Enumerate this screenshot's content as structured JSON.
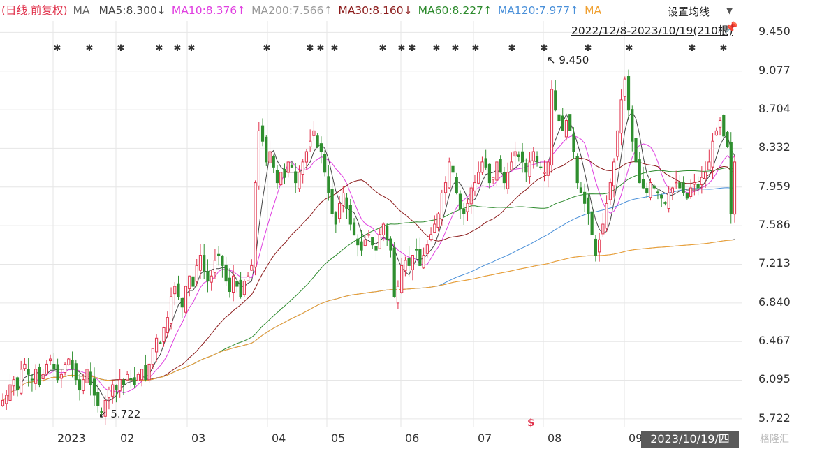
{
  "legend": {
    "prefix": "(日线,前复权)",
    "ma_label": "MA",
    "items": [
      {
        "text": "MA5:8.300↓",
        "color": "#444444"
      },
      {
        "text": "MA10:8.376↑",
        "color": "#e040e0"
      },
      {
        "text": "MA200:7.566↑",
        "color": "#999999"
      },
      {
        "text": "MA30:8.160↓",
        "color": "#8b1a1a"
      },
      {
        "text": "MA60:8.227↑",
        "color": "#2e8b2e"
      },
      {
        "text": "MA120:7.977↑",
        "color": "#4a90d9"
      },
      {
        "text": "MA",
        "color": "#f0a030"
      }
    ]
  },
  "controls": {
    "settings_label": "设置均线",
    "range_text": "2022/12/8-2023/10/19(210根)",
    "pin_icon": "pin-icon",
    "caret_icon": "chevron-down-icon"
  },
  "crosshair_date": "2023/10/19/四",
  "watermark": "格隆汇",
  "annotations": {
    "high": "↖ 9.450",
    "low": "↙ 5.722",
    "marker": "$"
  },
  "colors": {
    "up": "#e0314b",
    "down": "#2f8f2f",
    "grid": "#e6e6e6"
  },
  "chart_data": {
    "type": "candlestick",
    "ylim": [
      5.64,
      9.56
    ],
    "yticks": [
      "9.450",
      "9.077",
      "8.704",
      "8.332",
      "7.959",
      "7.586",
      "7.213",
      "6.840",
      "6.467",
      "6.095",
      "5.722"
    ],
    "xlabels": [
      "2023",
      "02",
      "03",
      "04",
      "05",
      "06",
      "07",
      "08",
      "09"
    ],
    "high_value": 9.45,
    "low_value": 5.722,
    "bar_count": 210,
    "closes": [
      5.9,
      5.95,
      6.05,
      6.1,
      6.0,
      6.2,
      6.25,
      6.15,
      6.1,
      6.2,
      6.05,
      6.15,
      6.25,
      6.3,
      6.2,
      6.1,
      6.15,
      6.25,
      6.3,
      6.2,
      6.1,
      6.0,
      6.1,
      6.2,
      6.05,
      5.95,
      5.85,
      5.78,
      5.9,
      6.0,
      6.05,
      6.0,
      6.1,
      6.05,
      6.15,
      6.1,
      6.05,
      6.15,
      6.2,
      6.1,
      6.25,
      6.4,
      6.5,
      6.45,
      6.6,
      6.7,
      6.9,
      7.0,
      6.9,
      6.8,
      7.0,
      7.1,
      7.0,
      7.2,
      7.3,
      7.15,
      7.05,
      7.1,
      7.25,
      7.3,
      7.2,
      7.05,
      6.95,
      7.1,
      7.0,
      6.9,
      7.05,
      7.1,
      7.2,
      8.0,
      8.5,
      8.4,
      8.2,
      8.3,
      8.15,
      8.0,
      8.1,
      8.05,
      8.2,
      8.15,
      8.0,
      8.1,
      8.2,
      8.3,
      8.4,
      8.5,
      8.35,
      8.3,
      8.1,
      7.9,
      7.7,
      7.6,
      7.8,
      7.9,
      7.75,
      7.6,
      7.5,
      7.4,
      7.35,
      7.45,
      7.5,
      7.4,
      7.35,
      7.5,
      7.6,
      7.45,
      7.35,
      6.9,
      7.0,
      7.2,
      7.25,
      7.2,
      7.3,
      7.35,
      7.2,
      7.3,
      7.4,
      7.5,
      7.6,
      7.7,
      7.9,
      8.0,
      8.2,
      8.1,
      7.9,
      7.75,
      7.7,
      7.8,
      7.95,
      8.0,
      8.1,
      8.2,
      8.15,
      8.0,
      8.05,
      8.2,
      8.1,
      8.0,
      8.1,
      8.2,
      8.3,
      8.25,
      8.2,
      8.1,
      8.2,
      8.3,
      8.2,
      8.15,
      8.1,
      8.2,
      8.9,
      8.7,
      8.6,
      8.5,
      8.6,
      8.5,
      8.3,
      8.0,
      7.9,
      7.8,
      7.7,
      7.5,
      7.3,
      7.45,
      7.6,
      7.8,
      8.0,
      8.2,
      8.5,
      8.8,
      9.0,
      8.7,
      8.4,
      8.2,
      8.0,
      7.95,
      7.9,
      8.0,
      7.95,
      7.9,
      7.85,
      7.8,
      7.9,
      7.95,
      8.0,
      7.95,
      7.9,
      7.85,
      7.95,
      8.0,
      7.95,
      8.05,
      8.1,
      8.2,
      8.4,
      8.5,
      8.6,
      8.45,
      8.35,
      7.7,
      8.2
    ],
    "signal_x": [
      82,
      128,
      173,
      228,
      254,
      274,
      382,
      444,
      459,
      479,
      548,
      575,
      590,
      625,
      652,
      681,
      733,
      779,
      842,
      901,
      991,
      1036
    ],
    "series": [
      {
        "name": "MA5",
        "color": "#444444",
        "line": "ma5"
      },
      {
        "name": "MA10",
        "color": "#e040e0",
        "line": "ma10"
      },
      {
        "name": "MA30",
        "color": "#8b1a1a",
        "line": "ma30"
      },
      {
        "name": "MA60",
        "color": "#2e8b2e",
        "line": "ma60"
      },
      {
        "name": "MA120",
        "color": "#4a90d9",
        "line": "ma120"
      },
      {
        "name": "MA200",
        "color": "#999999",
        "line": "ma200"
      },
      {
        "name": "MA",
        "color": "#f0a030",
        "line": "ma250"
      }
    ]
  }
}
